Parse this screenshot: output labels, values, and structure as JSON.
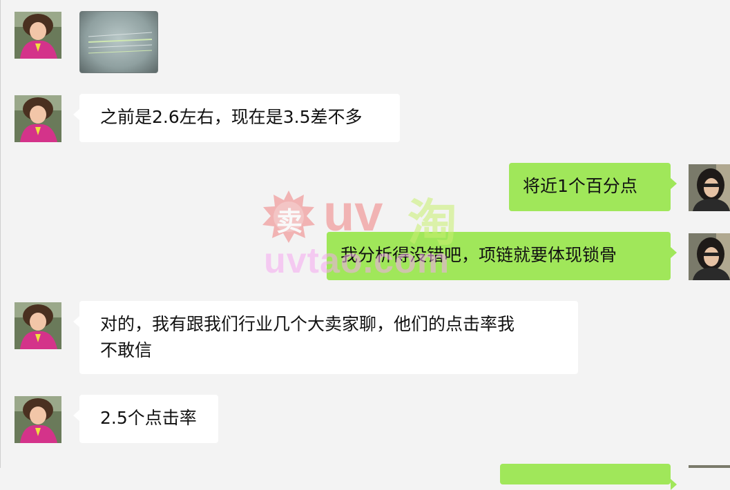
{
  "messages": [
    {
      "id": "m1",
      "side": "in",
      "type": "image"
    },
    {
      "id": "m2",
      "side": "in",
      "type": "text",
      "text": "之前是2.6左右，现在是3.5差不多"
    },
    {
      "id": "m3",
      "side": "out",
      "type": "text",
      "text": "将近1个百分点"
    },
    {
      "id": "m4",
      "side": "out",
      "type": "text",
      "text": "我分析得没错吧，项链就要体现锁骨"
    },
    {
      "id": "m5",
      "side": "in",
      "type": "text",
      "line1": "对的，我有跟我们行业几个大卖家聊，他们的点击率我",
      "line2": "不敢信"
    },
    {
      "id": "m6",
      "side": "in",
      "type": "text",
      "text": "2.5个点击率"
    },
    {
      "id": "m7",
      "side": "out",
      "type": "text",
      "text": ""
    }
  ],
  "watermark": {
    "seal_char": "卖",
    "top_text": "uv",
    "tao_char": "淘",
    "bottom_text": "uvtao.com"
  },
  "colors": {
    "background": "#f3f3f3",
    "incoming_bubble": "#ffffff",
    "outgoing_bubble": "#a0e75a"
  }
}
